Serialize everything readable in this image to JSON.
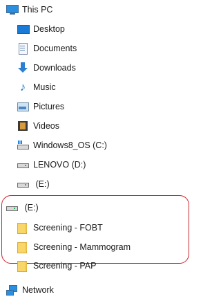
{
  "nav": {
    "this_pc": "This PC",
    "items": [
      {
        "label": "Desktop",
        "icon": "desktop-icon"
      },
      {
        "label": "Documents",
        "icon": "documents-icon"
      },
      {
        "label": "Downloads",
        "icon": "downloads-icon"
      },
      {
        "label": "Music",
        "icon": "music-icon"
      },
      {
        "label": "Pictures",
        "icon": "pictures-icon"
      },
      {
        "label": "Videos",
        "icon": "videos-icon"
      },
      {
        "label": "Windows8_OS (C:)",
        "icon": "windows-drive-icon"
      },
      {
        "label": "LENOVO (D:)",
        "icon": "drive-icon"
      },
      {
        "label": " (E:)",
        "icon": "drive-icon"
      }
    ],
    "removable_drive": {
      "label": " (E:)",
      "icon": "drive-icon",
      "folders": [
        {
          "label": "Screening - FOBT",
          "icon": "folder-icon"
        },
        {
          "label": "Screening - Mammogram",
          "icon": "folder-icon"
        },
        {
          "label": "Screening - PAP",
          "icon": "folder-icon"
        }
      ]
    },
    "network": "Network"
  },
  "colors": {
    "highlight": "#d0202a",
    "folder": "#f9d66a",
    "accent": "#2b8fe0"
  }
}
